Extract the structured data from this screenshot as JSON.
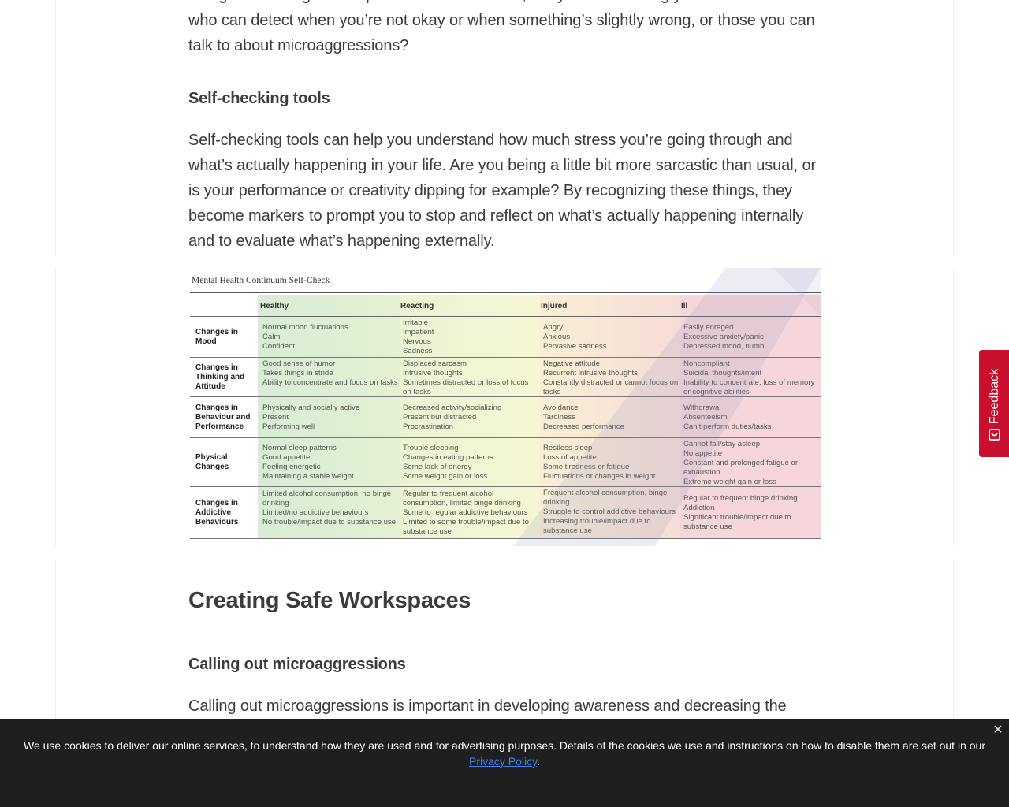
{
  "article": {
    "intro_text": "that good existing that helps form each of us. So, are you surrounding yourself with those who can detect when you’re not okay or when something’s slightly wrong, or those you can talk to about microaggressions?",
    "section_self_check": {
      "heading": "Self-checking tools",
      "body": "Self-checking tools can help you understand how much stress you’re going through and what’s actually happening in your life. Are you being a little bit more sarcastic than usual, or is your performance or creativity dipping for example? By recognizing these things, they become markers to prompt you to stop and reflect on what’s actually happening internally and to evaluate what’s happening externally."
    },
    "section_workspaces": {
      "heading": "Creating Safe Workspaces",
      "subheading": "Calling out microaggressions",
      "body": "Calling out microaggressions is important in developing awareness and decreasing the"
    }
  },
  "continuum": {
    "title": "Mental Health Continuum Self-Check",
    "columns": [
      "Healthy",
      "Reacting",
      "Injured",
      "Ill"
    ],
    "rows": [
      {
        "label": "Changes in Mood",
        "cells": [
          [
            "Normal mood fluctuations",
            "Calm",
            "Confident"
          ],
          [
            "Irritable",
            "Impatient",
            "Nervous",
            "Sadness"
          ],
          [
            "Angry",
            "Anxious",
            "Pervasive sadness"
          ],
          [
            "Easily enraged",
            "Excessive anxiety/panic",
            "Depressed mood, numb"
          ]
        ]
      },
      {
        "label": "Changes in Thinking and Attitude",
        "cells": [
          [
            "Good sense of humor",
            "Takes things in stride",
            "Ability to concentrate and focus on tasks"
          ],
          [
            "Displaced sarcasm",
            "Intrusive thoughts",
            "Sometimes distracted or loss of focus on tasks"
          ],
          [
            "Negative attitude",
            "Recurrent intrusive thoughts",
            "Constantly distracted or cannot focus on tasks"
          ],
          [
            "Noncompliant",
            "Suicidal thoughts/intent",
            "Inability to concentrate, loss of memory or cognitive abilities"
          ]
        ]
      },
      {
        "label": "Changes in Behaviour and Performance",
        "cells": [
          [
            "Physically and socially active",
            "Present",
            "Performing well"
          ],
          [
            "Decreased activity/socializing",
            "Present but distracted",
            "Procrastination"
          ],
          [
            "Avoidance",
            "Tardiness",
            "Decreased performance"
          ],
          [
            "Withdrawal",
            "Absenteeism",
            "Can’t perform duties/tasks"
          ]
        ]
      },
      {
        "label": "Physical Changes",
        "cells": [
          [
            "Normal sleep patterns",
            "Good appetite",
            "Feeling energetic",
            "Maintaining a stable weight"
          ],
          [
            "Trouble sleeping",
            "Changes in eating patterns",
            "Some lack of energy",
            "Some weight gain or loss"
          ],
          [
            "Restless sleep",
            "Loss of appetite",
            "Some tiredness or fatigue",
            "Fluctuations or changes in weight"
          ],
          [
            "Cannot fall/stay asleep",
            "No appetite",
            "Constant and prolonged fatigue or exhaustion",
            "Extreme weight gain or loss"
          ]
        ]
      },
      {
        "label": "Changes in Addictive Behaviours",
        "cells": [
          [
            "Limited alcohol consumption, no binge drinking",
            "Limited/no addictive behaviours",
            "No trouble/impact due to substance use"
          ],
          [
            "Regular to frequent alcohol consumption, limited binge drinking",
            "Some to regular addictive behaviours",
            "Limited to some trouble/impact due to substance use"
          ],
          [
            "Frequent alcohol consumption, binge drinking",
            "Struggle to control addictive behaviours",
            "Increasing trouble/impact due to substance use"
          ],
          [
            "Regular to frequent binge drinking",
            "Addiction",
            "Significant trouble/impact due to substance use"
          ]
        ]
      }
    ]
  },
  "feedback": {
    "label": "Feedback",
    "icon": "feedback-icon"
  },
  "cookie_banner": {
    "text": "We use cookies to deliver our online services, to understand how they are used and for advertising purposes. Details of the cookies we use and instructions on how to disable them are set out in our",
    "link_text": "Privacy Policy",
    "suffix": ".",
    "close_icon": "close-icon"
  }
}
